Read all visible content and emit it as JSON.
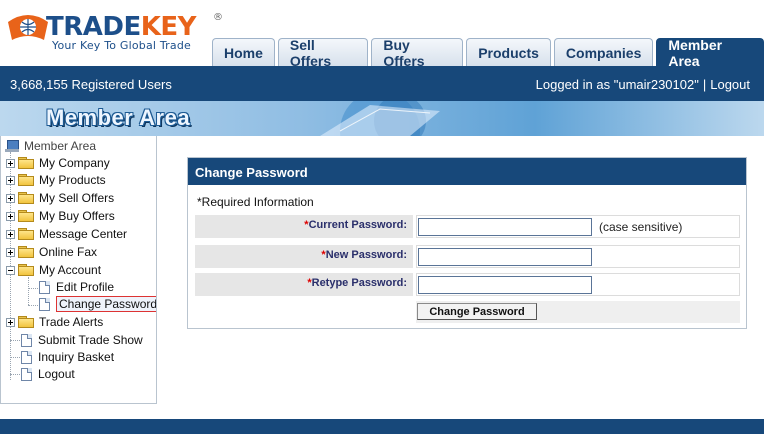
{
  "brand": {
    "name_part1": "TRADE",
    "name_part2": "KEY",
    "registered_mark": "®",
    "tagline": "Your Key To Global Trade"
  },
  "nav": {
    "tabs": [
      {
        "label": "Home"
      },
      {
        "label": "Sell Offers"
      },
      {
        "label": "Buy Offers"
      },
      {
        "label": "Products"
      },
      {
        "label": "Companies"
      },
      {
        "label": "Member Area",
        "active": true
      }
    ]
  },
  "status": {
    "registered_users": "3,668,155  Registered Users",
    "logged_in": "Logged in as \"umair230102\"",
    "separator": "|",
    "logout": "Logout"
  },
  "banner": {
    "title": "Member Area"
  },
  "sidebar": {
    "root": "Member Area",
    "items": [
      {
        "label": "My Company",
        "type": "folder",
        "expanded": false
      },
      {
        "label": "My Products",
        "type": "folder",
        "expanded": false
      },
      {
        "label": "My Sell Offers",
        "type": "folder",
        "expanded": false
      },
      {
        "label": "My Buy Offers",
        "type": "folder",
        "expanded": false
      },
      {
        "label": "Message Center",
        "type": "folder",
        "expanded": false
      },
      {
        "label": "Online Fax",
        "type": "folder",
        "expanded": false
      },
      {
        "label": "My Account",
        "type": "folder",
        "expanded": true
      },
      {
        "label": "Edit Profile",
        "type": "page"
      },
      {
        "label": "Change Password",
        "type": "page",
        "selected": true
      },
      {
        "label": "Trade Alerts",
        "type": "folder",
        "expanded": false
      },
      {
        "label": "Submit Trade Show",
        "type": "page"
      },
      {
        "label": "Inquiry Basket",
        "type": "page"
      },
      {
        "label": "Logout",
        "type": "page"
      }
    ]
  },
  "form": {
    "title": "Change Password",
    "required_info": "*Required Information",
    "required_mark": "*",
    "fields": [
      {
        "label": "Current Password:",
        "value": "",
        "note": "(case sensitive)"
      },
      {
        "label": "New Password:",
        "value": "",
        "note": ""
      },
      {
        "label": "Retype Password:",
        "value": "",
        "note": ""
      }
    ],
    "submit_label": "Change Password"
  },
  "colors": {
    "navy": "#17487a",
    "brand_orange": "#e8631a",
    "required_red": "#dd0000"
  }
}
